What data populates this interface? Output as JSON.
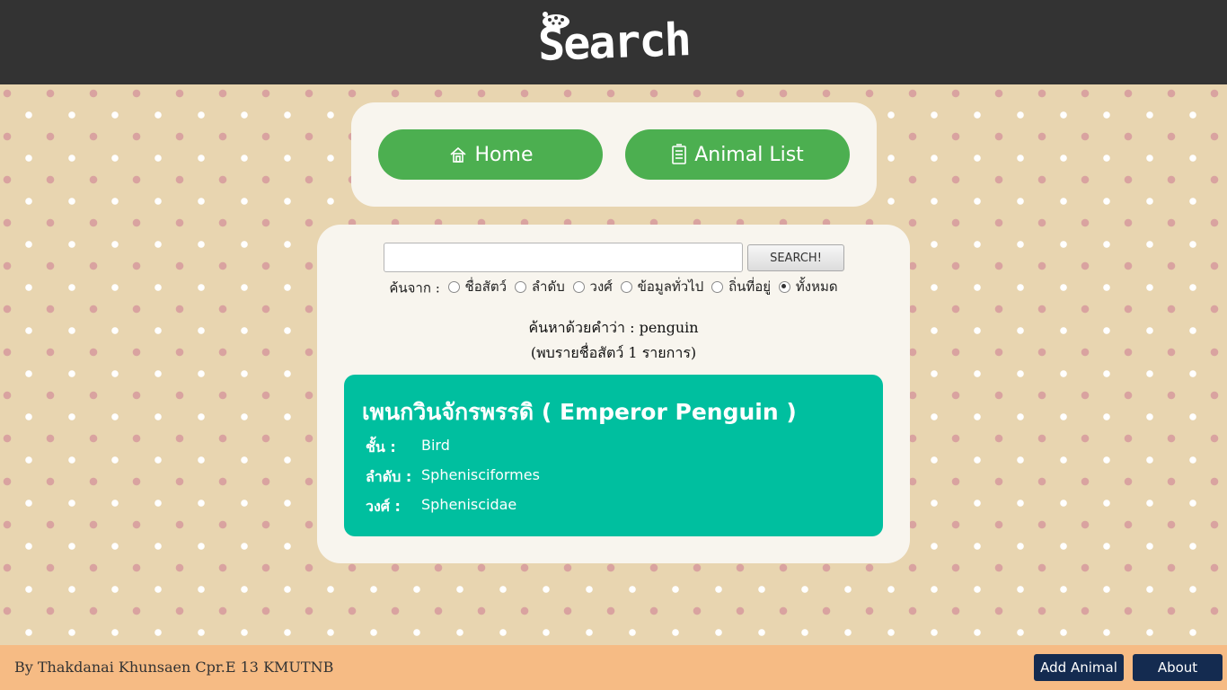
{
  "header": {
    "logo_text": "Search",
    "logo_icon": "ladybug-icon"
  },
  "nav": {
    "home_label": "Home",
    "home_icon": "house-icon",
    "animal_list_label": "Animal List",
    "animal_list_icon": "document-icon"
  },
  "search": {
    "input_value": "",
    "button_label": "SEARCH!",
    "filter_label": "ค้นจาก :",
    "options": [
      {
        "label": "ชื่อสัตว์",
        "checked": false
      },
      {
        "label": "ลำดับ",
        "checked": false
      },
      {
        "label": "วงศ์",
        "checked": false
      },
      {
        "label": "ข้อมูลทั่วไป",
        "checked": false
      },
      {
        "label": "ถิ่นที่อยู่",
        "checked": false
      },
      {
        "label": "ทั้งหมด",
        "checked": true
      }
    ],
    "query_line": "ค้นหาด้วยคำว่า : penguin",
    "count_line": "(พบรายชื่อสัตว์ 1 รายการ)"
  },
  "result": {
    "title": "เพนกวินจักรพรรดิ ( Emperor Penguin )",
    "rows": [
      {
        "label": "ชั้น :",
        "value": "Bird"
      },
      {
        "label": "ลำดับ :",
        "value": "Sphenisciformes"
      },
      {
        "label": "วงศ์ :",
        "value": "Spheniscidae"
      }
    ]
  },
  "footer": {
    "credit": "By Thakdanai Khunsaen Cpr.E 13 KMUTNB",
    "add_animal_label": "Add Animal",
    "about_label": "About"
  },
  "colors": {
    "header_bg": "#333333",
    "nav_button": "#4caf50",
    "result_card": "#00bf9f",
    "footer_bg": "#f6bb84",
    "footer_button": "#142b50"
  }
}
